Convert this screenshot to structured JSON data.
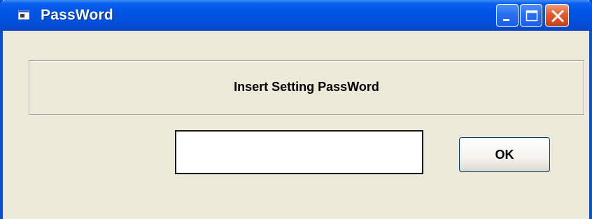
{
  "window": {
    "title": "PassWord",
    "title_icon": "window-icon",
    "controls": {
      "minimize_icon": "minimize-icon",
      "maximize_icon": "maximize-icon",
      "close_icon": "close-icon"
    }
  },
  "dialog": {
    "prompt": "Insert Setting PassWord",
    "password_value": "",
    "ok_label": "OK"
  },
  "colors": {
    "titlebar": "#0054e3",
    "window_background": "#ece9d8",
    "close_button": "#e25c2f",
    "title_text": "#ffffff"
  }
}
